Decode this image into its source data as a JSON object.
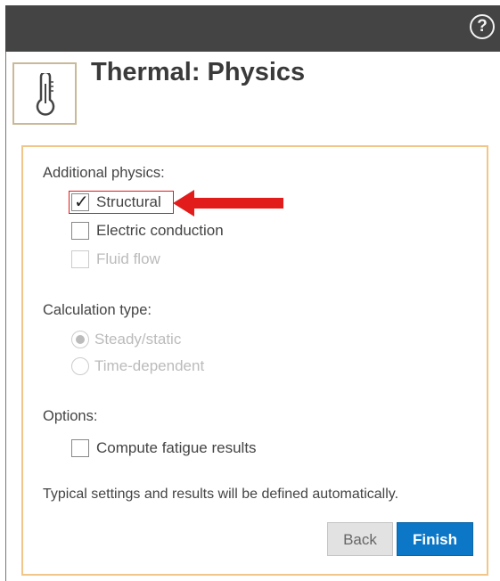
{
  "header": {
    "title": "Thermal: Physics",
    "help_icon": "question-circle-icon",
    "step_icon": "thermometer-icon"
  },
  "additional_physics": {
    "label": "Additional physics:",
    "items": [
      {
        "label": "Structural",
        "checked": true,
        "enabled": true,
        "highlighted": true
      },
      {
        "label": "Electric conduction",
        "checked": false,
        "enabled": true
      },
      {
        "label": "Fluid flow",
        "checked": false,
        "enabled": false
      }
    ]
  },
  "calculation_type": {
    "label": "Calculation type:",
    "options": [
      {
        "label": "Steady/static",
        "selected": true,
        "enabled": false
      },
      {
        "label": "Time-dependent",
        "selected": false,
        "enabled": false
      }
    ]
  },
  "options": {
    "label": "Options:",
    "items": [
      {
        "label": "Compute fatigue results",
        "checked": false,
        "enabled": true
      }
    ]
  },
  "note": "Typical settings and results will be defined automatically.",
  "buttons": {
    "back": "Back",
    "finish": "Finish"
  },
  "colors": {
    "accent": "#0c77c7",
    "panel_border": "#f2c689",
    "highlight": "#e21b1b",
    "topbar": "#444444"
  }
}
